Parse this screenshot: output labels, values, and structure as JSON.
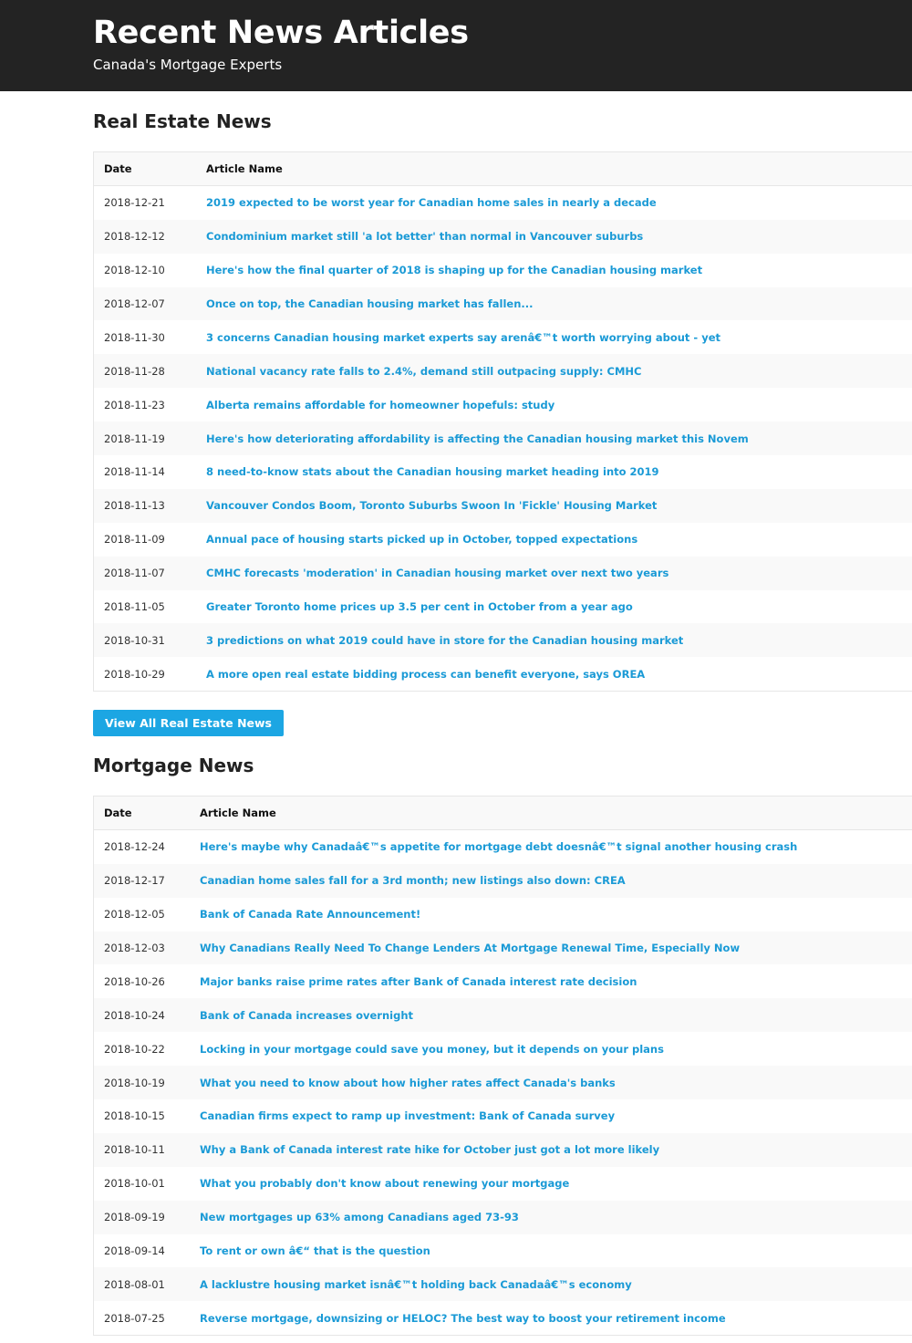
{
  "header": {
    "title": "Recent News Articles",
    "tagline": "Canada's Mortgage Experts"
  },
  "real_estate": {
    "heading": "Real Estate News",
    "col_date": "Date",
    "col_name": "Article Name",
    "rows": [
      {
        "date": "2018-12-21",
        "title": "2019 expected to be worst year for Canadian home sales in nearly a decade"
      },
      {
        "date": "2018-12-12",
        "title": "Condominium market still 'a lot better' than normal in Vancouver suburbs"
      },
      {
        "date": "2018-12-10",
        "title": "Here's how the final quarter of 2018 is shaping up for the Canadian housing market"
      },
      {
        "date": "2018-12-07",
        "title": "Once on top, the Canadian housing market has fallen..."
      },
      {
        "date": "2018-11-30",
        "title": "3 concerns Canadian housing market experts say arenâ€™t worth worrying about - yet"
      },
      {
        "date": "2018-11-28",
        "title": "National vacancy rate falls to 2.4%, demand still outpacing supply: CMHC"
      },
      {
        "date": "2018-11-23",
        "title": "Alberta remains affordable for homeowner hopefuls: study"
      },
      {
        "date": "2018-11-19",
        "title": "Here's how deteriorating affordability is affecting the Canadian housing market this Novem"
      },
      {
        "date": "2018-11-14",
        "title": "8 need-to-know stats about the Canadian housing market heading into 2019"
      },
      {
        "date": "2018-11-13",
        "title": "Vancouver Condos Boom, Toronto Suburbs Swoon In 'Fickle' Housing Market"
      },
      {
        "date": "2018-11-09",
        "title": "Annual pace of housing starts picked up in October, topped expectations"
      },
      {
        "date": "2018-11-07",
        "title": "CMHC forecasts 'moderation' in Canadian housing market over next two years"
      },
      {
        "date": "2018-11-05",
        "title": "Greater Toronto home prices up 3.5 per cent in October from a year ago"
      },
      {
        "date": "2018-10-31",
        "title": "3 predictions on what 2019 could have in store for the Canadian housing market"
      },
      {
        "date": "2018-10-29",
        "title": "A more open real estate bidding process can benefit everyone, says OREA"
      }
    ],
    "button_label": "View All Real Estate News"
  },
  "mortgage": {
    "heading": "Mortgage News",
    "col_date": "Date",
    "col_name": "Article Name",
    "rows": [
      {
        "date": "2018-12-24",
        "title": "Here's maybe why Canadaâ€™s appetite for mortgage debt doesnâ€™t signal another housing crash"
      },
      {
        "date": "2018-12-17",
        "title": "Canadian home sales fall for a 3rd month; new listings also down: CREA"
      },
      {
        "date": "2018-12-05",
        "title": "Bank of Canada Rate Announcement!"
      },
      {
        "date": "2018-12-03",
        "title": "Why Canadians Really Need To Change Lenders At Mortgage Renewal Time, Especially Now"
      },
      {
        "date": "2018-10-26",
        "title": "Major banks raise prime rates after Bank of Canada interest rate decision"
      },
      {
        "date": "2018-10-24",
        "title": "Bank of Canada increases overnight"
      },
      {
        "date": "2018-10-22",
        "title": "Locking in your mortgage could save you money, but it depends on your plans"
      },
      {
        "date": "2018-10-19",
        "title": "What you need to know about how higher rates affect Canada's banks"
      },
      {
        "date": "2018-10-15",
        "title": "Canadian firms expect to ramp up investment: Bank of Canada survey"
      },
      {
        "date": "2018-10-11",
        "title": "Why a Bank of Canada interest rate hike for October just got a lot more likely"
      },
      {
        "date": "2018-10-01",
        "title": "What you probably don't know about renewing your mortgage"
      },
      {
        "date": "2018-09-19",
        "title": "New mortgages up 63% among Canadians aged 73-93"
      },
      {
        "date": "2018-09-14",
        "title": "To rent or own â€“ that is the question"
      },
      {
        "date": "2018-08-01",
        "title": "A lacklustre housing market isnâ€™t holding back Canadaâ€™s economy"
      },
      {
        "date": "2018-07-25",
        "title": "Reverse mortgage, downsizing or HELOC? The best way to boost your retirement income"
      }
    ]
  },
  "colors": {
    "header_bg": "#232323",
    "link": "#1a9ad6",
    "button_bg": "#1ca6e3",
    "row_stripe": "#f9f9f9"
  }
}
